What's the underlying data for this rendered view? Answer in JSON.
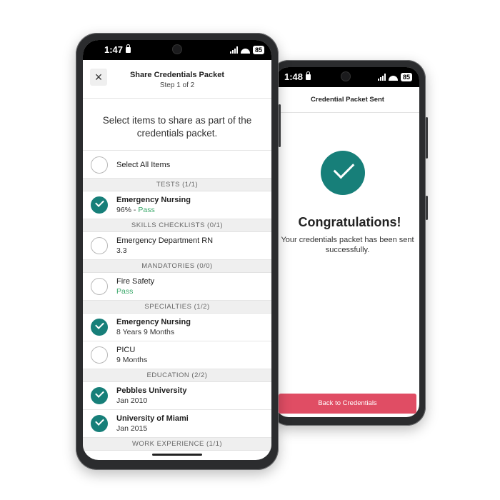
{
  "back_phone": {
    "status": {
      "time": "1:48",
      "battery": "85"
    },
    "header_title": "Credential Packet Sent",
    "congrats": "Congratulations!",
    "message": "Your credentials packet has been sent successfully.",
    "button_label": "Back to Credentials"
  },
  "front_phone": {
    "status": {
      "time": "1:47",
      "battery": "85"
    },
    "header": {
      "title": "Share Credentials Packet",
      "step": "Step 1 of 2"
    },
    "instruction": "Select items to share as part of the credentials packet.",
    "select_all": "Select All Items",
    "sections": [
      {
        "label": "TESTS (1/1)"
      },
      {
        "label": "SKILLS CHECKLISTS (0/1)"
      },
      {
        "label": "MANDATORIES (0/0)"
      },
      {
        "label": "SPECIALTIES (1/2)"
      },
      {
        "label": "EDUCATION (2/2)"
      },
      {
        "label": "WORK EXPERIENCE (1/1)"
      }
    ],
    "items": [
      {
        "title": "Emergency Nursing",
        "sub": "96% - ",
        "status": "Pass",
        "checked": true
      },
      {
        "title": "Emergency Department RN",
        "sub": "3.3",
        "checked": false
      },
      {
        "title": "Fire Safety",
        "status": "Pass",
        "checked": false
      },
      {
        "title": "Emergency Nursing",
        "sub": "8 Years 9 Months",
        "checked": true
      },
      {
        "title": "PICU",
        "sub": "9 Months",
        "checked": false
      },
      {
        "title": "Pebbles University",
        "sub": "Jan 2010",
        "checked": true
      },
      {
        "title": "University of Miami",
        "sub": "Jan 2015",
        "checked": true
      }
    ],
    "colors": {
      "accent": "#177f79",
      "pass": "#3aa86a",
      "button": "#e04d64"
    }
  }
}
